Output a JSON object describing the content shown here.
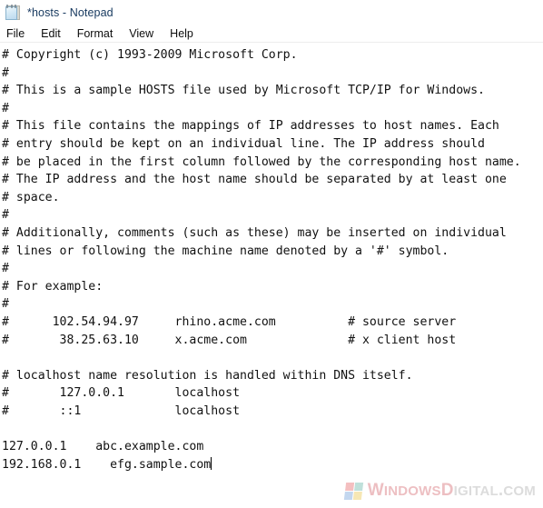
{
  "window": {
    "title": "*hosts - Notepad",
    "icon": "notepad-icon"
  },
  "menubar": {
    "items": [
      {
        "label": "File"
      },
      {
        "label": "Edit"
      },
      {
        "label": "Format"
      },
      {
        "label": "View"
      },
      {
        "label": "Help"
      }
    ]
  },
  "editor": {
    "filename": "hosts",
    "modified": true,
    "lines": [
      "# Copyright (c) 1993-2009 Microsoft Corp.",
      "#",
      "# This is a sample HOSTS file used by Microsoft TCP/IP for Windows.",
      "#",
      "# This file contains the mappings of IP addresses to host names. Each",
      "# entry should be kept on an individual line. The IP address should",
      "# be placed in the first column followed by the corresponding host name.",
      "# The IP address and the host name should be separated by at least one",
      "# space.",
      "#",
      "# Additionally, comments (such as these) may be inserted on individual",
      "# lines or following the machine name denoted by a '#' symbol.",
      "#",
      "# For example:",
      "#",
      "#      102.54.94.97     rhino.acme.com          # source server",
      "#       38.25.63.10     x.acme.com              # x client host",
      "",
      "# localhost name resolution is handled within DNS itself.",
      "#       127.0.0.1       localhost",
      "#       ::1             localhost",
      "",
      "127.0.0.1    abc.example.com",
      "192.168.0.1    efg.sample.com"
    ],
    "caret_line_index": 23,
    "caret_visible": true
  },
  "watermark": {
    "text_parts": [
      {
        "text": "W",
        "style": "red"
      },
      {
        "text": "INDOWS",
        "style": "red small"
      },
      {
        "text": "D",
        "style": "red"
      },
      {
        "text": "IGITAL",
        "style": "grey small"
      },
      {
        "text": ".",
        "style": "grey"
      },
      {
        "text": "COM",
        "style": "grey small"
      }
    ],
    "full_text": "WINDOWSDIGITAL.COM",
    "logo": "windows-digital-logo"
  },
  "colors": {
    "title_text": "#16385e",
    "body_text": "#111111",
    "background": "#ffffff",
    "menu_separator": "#ededed",
    "watermark_red": "#edbfc2",
    "watermark_grey": "#dcdcdc"
  }
}
